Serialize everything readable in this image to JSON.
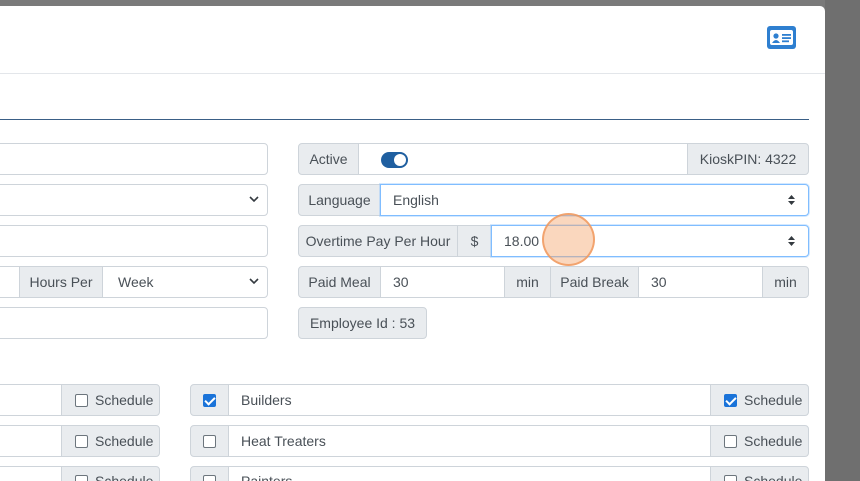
{
  "form": {
    "active_label": "Active",
    "active_on": true,
    "kiosk_pin": "KioskPIN: 4322",
    "language_label": "Language",
    "language_value": "English",
    "overtime_label": "Overtime Pay Per Hour",
    "currency_symbol": "$",
    "overtime_value": "18.00",
    "hours_per_label": "Hours Per",
    "hours_per_value": "Week",
    "paid_meal_label": "Paid Meal",
    "paid_meal_value": "30",
    "paid_meal_unit": "min",
    "paid_break_label": "Paid Break",
    "paid_break_value": "30",
    "paid_break_unit": "min",
    "employee_id": "Employee Id : 53"
  },
  "departments": {
    "left_schedule_labels": [
      "Schedule",
      "Schedule",
      "Schedule"
    ],
    "left_schedule_checked": [
      false,
      false,
      false
    ],
    "items": [
      {
        "name": "Builders",
        "checked": true,
        "schedule_label": "Schedule",
        "schedule_checked": true
      },
      {
        "name": "Heat Treaters",
        "checked": false,
        "schedule_label": "Schedule",
        "schedule_checked": false
      },
      {
        "name": "Painters",
        "checked": false,
        "schedule_label": "Schedule",
        "schedule_checked": false
      }
    ]
  },
  "icons": {
    "header_button": "id-card-icon"
  },
  "colors": {
    "primary": "#1f5fa0",
    "checkbox": "#1a73d9",
    "addon_bg": "#e9ecef"
  }
}
